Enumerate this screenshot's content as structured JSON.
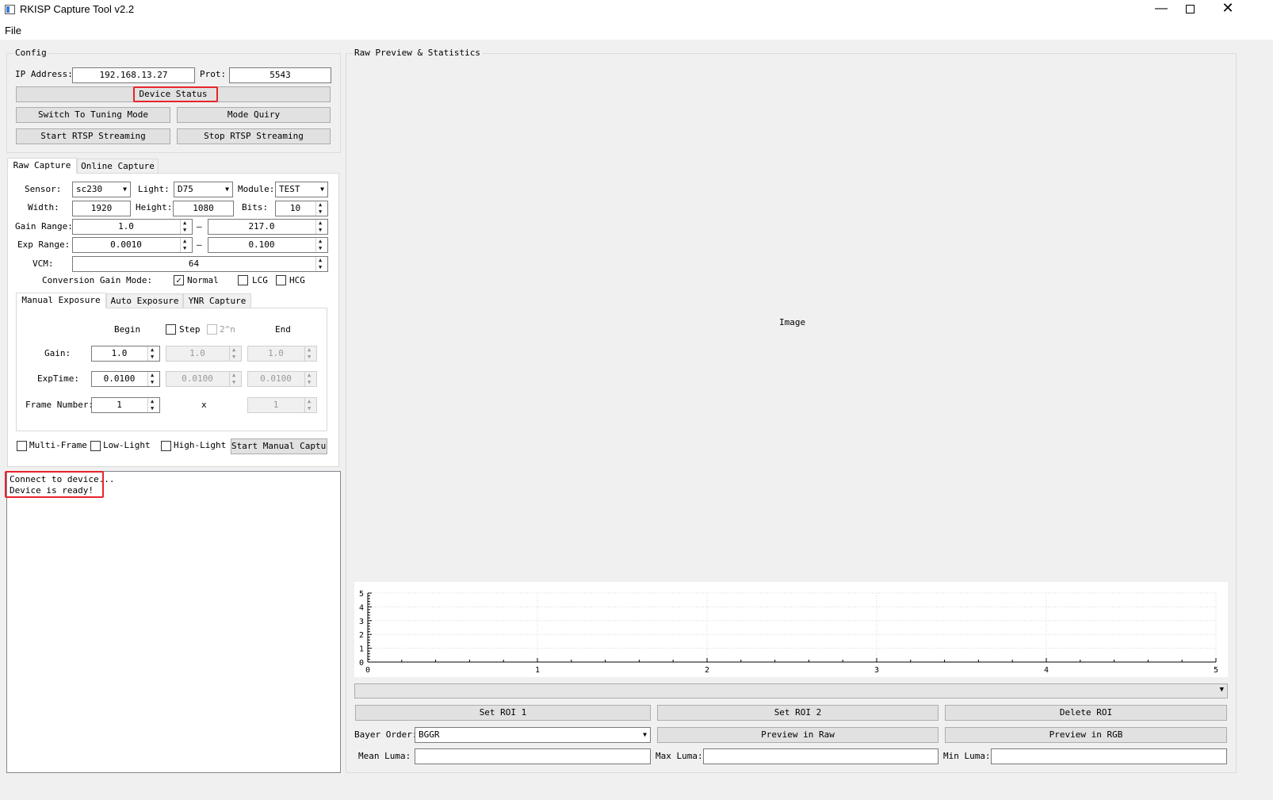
{
  "window": {
    "title": "RKISP Capture Tool v2.2"
  },
  "menu": {
    "file": "File"
  },
  "config": {
    "title": "Config",
    "ip_label": "IP Address:",
    "ip_value": "192.168.13.27",
    "port_label": "Prot:",
    "port_value": "5543",
    "device_status": "Device Status",
    "switch_tuning": "Switch To Tuning Mode",
    "mode_quiry": "Mode Quiry",
    "start_rtsp": "Start RTSP Streaming",
    "stop_rtsp": "Stop RTSP Streaming"
  },
  "tabs": {
    "raw": "Raw Capture",
    "online": "Online Capture"
  },
  "raw": {
    "sensor_label": "Sensor:",
    "sensor_value": "sc230",
    "light_label": "Light:",
    "light_value": "D75",
    "module_label": "Module:",
    "module_value": "TEST",
    "width_label": "Width:",
    "width_value": "1920",
    "height_label": "Height:",
    "height_value": "1080",
    "bits_label": "Bits:",
    "bits_value": "10",
    "gain_range_label": "Gain Range:",
    "gain_min": "1.0",
    "gain_max": "217.0",
    "exp_range_label": "Exp Range:",
    "exp_min": "0.0010",
    "exp_max": "0.100",
    "dash": "—",
    "vcm_label": "VCM:",
    "vcm_value": "64",
    "cg_label": "Conversion Gain Mode:",
    "cg_normal": "Normal",
    "cg_lcg": "LCG",
    "cg_hcg": "HCG",
    "cg_normal_checked": true
  },
  "subtabs": {
    "manual": "Manual Exposure",
    "auto": "Auto Exposure",
    "ynr": "YNR Capture"
  },
  "manual": {
    "begin": "Begin",
    "step": "Step",
    "pow2": "2^n",
    "end": "End",
    "gain_label": "Gain:",
    "gain_begin": "1.0",
    "gain_step": "1.0",
    "gain_end": "1.0",
    "exptime_label": "ExpTime:",
    "exp_begin": "0.0100",
    "exp_step": "0.0100",
    "exp_end": "0.0100",
    "frame_label": "Frame Number:",
    "frame_begin": "1",
    "frame_x": "x",
    "frame_end": "1"
  },
  "options": {
    "multi": "Multi-Frame",
    "low": "Low-Light",
    "high": "High-Light",
    "start": "Start Manual Capture"
  },
  "log": {
    "line1": "Connect to device...",
    "line2": "Device is ready!"
  },
  "preview": {
    "title": "Raw Preview & Statistics",
    "image": "Image",
    "set_roi1": "Set ROI 1",
    "set_roi2": "Set ROI 2",
    "delete_roi": "Delete ROI",
    "bayer_label": "Bayer Order:",
    "bayer_value": "BGGR",
    "preview_raw": "Preview in Raw",
    "preview_rgb": "Preview in RGB",
    "mean_label": "Mean Luma:",
    "max_label": "Max Luma:",
    "min_label": "Min Luma:"
  },
  "chart_data": {
    "type": "line",
    "x": [],
    "series": [],
    "xlim": [
      0,
      5
    ],
    "ylim": [
      0,
      5
    ],
    "xticks": [
      "0",
      "1",
      "2",
      "3",
      "4",
      "5"
    ],
    "yticks": [
      "0",
      "1",
      "2",
      "3",
      "4",
      "5"
    ],
    "grid": true
  }
}
